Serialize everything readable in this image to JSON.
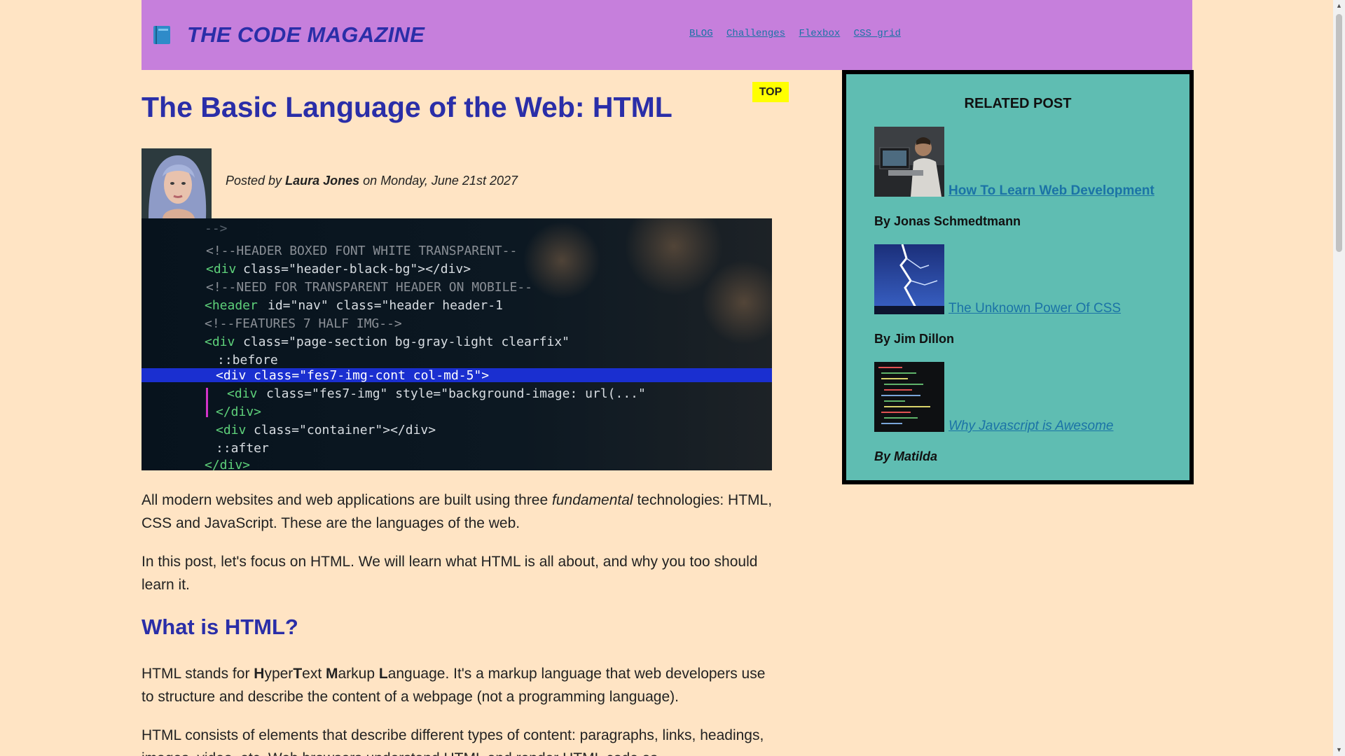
{
  "header": {
    "logo_icon": "book-icon",
    "site_title": "THE CODE MAGAZINE",
    "nav": [
      "BLOG",
      "Challenges",
      "Flexbox",
      "CSS grid"
    ]
  },
  "article": {
    "badge": "TOP",
    "title": "The Basic Language of the Web: HTML",
    "meta": {
      "prefix": "Posted by",
      "author": "Laura Jones",
      "middle": "on",
      "date": "Monday, June 21st 2027"
    },
    "p1": {
      "before": "All modern websites and web applications are built using three",
      "emph": "fundamental",
      "after": "technologies: HTML, CSS and JavaScript. These are the languages of the web."
    },
    "p2": "In this post, let's focus on HTML. We will learn what HTML is all about, and why you too should learn it.",
    "h2": "What is HTML?",
    "p3": {
      "before": "HTML stands for",
      "h": "H",
      "yper": "yper",
      "t": "T",
      "ext": "ext",
      "m": "M",
      "arkup": "arkup",
      "l": "L",
      "anguage": "anguage. It's a markup language that web developers use to structure and describe the content of a webpage (not a programming language)."
    },
    "p4": "HTML consists of elements that describe different types of content: paragraphs, links, headings, images, video, etc. Web browsers understand HTML and render HTML code as"
  },
  "sidebar": {
    "title": "RELATED POST",
    "posts": [
      {
        "title": "How To Learn Web Development",
        "author": "By Jonas Schmedtmann"
      },
      {
        "title": "The Unknown Power Of CSS",
        "author": "By Jim Dillon"
      },
      {
        "title": "Why Javascript is Awesome",
        "author": "By Matilda"
      }
    ]
  },
  "colors": {
    "background": "#ffe4c4",
    "header": "#c67fdc",
    "heading": "#2a2ea8",
    "sidebar": "#5fbdb2",
    "link": "#1b73a6",
    "badge": "#ffff00"
  }
}
